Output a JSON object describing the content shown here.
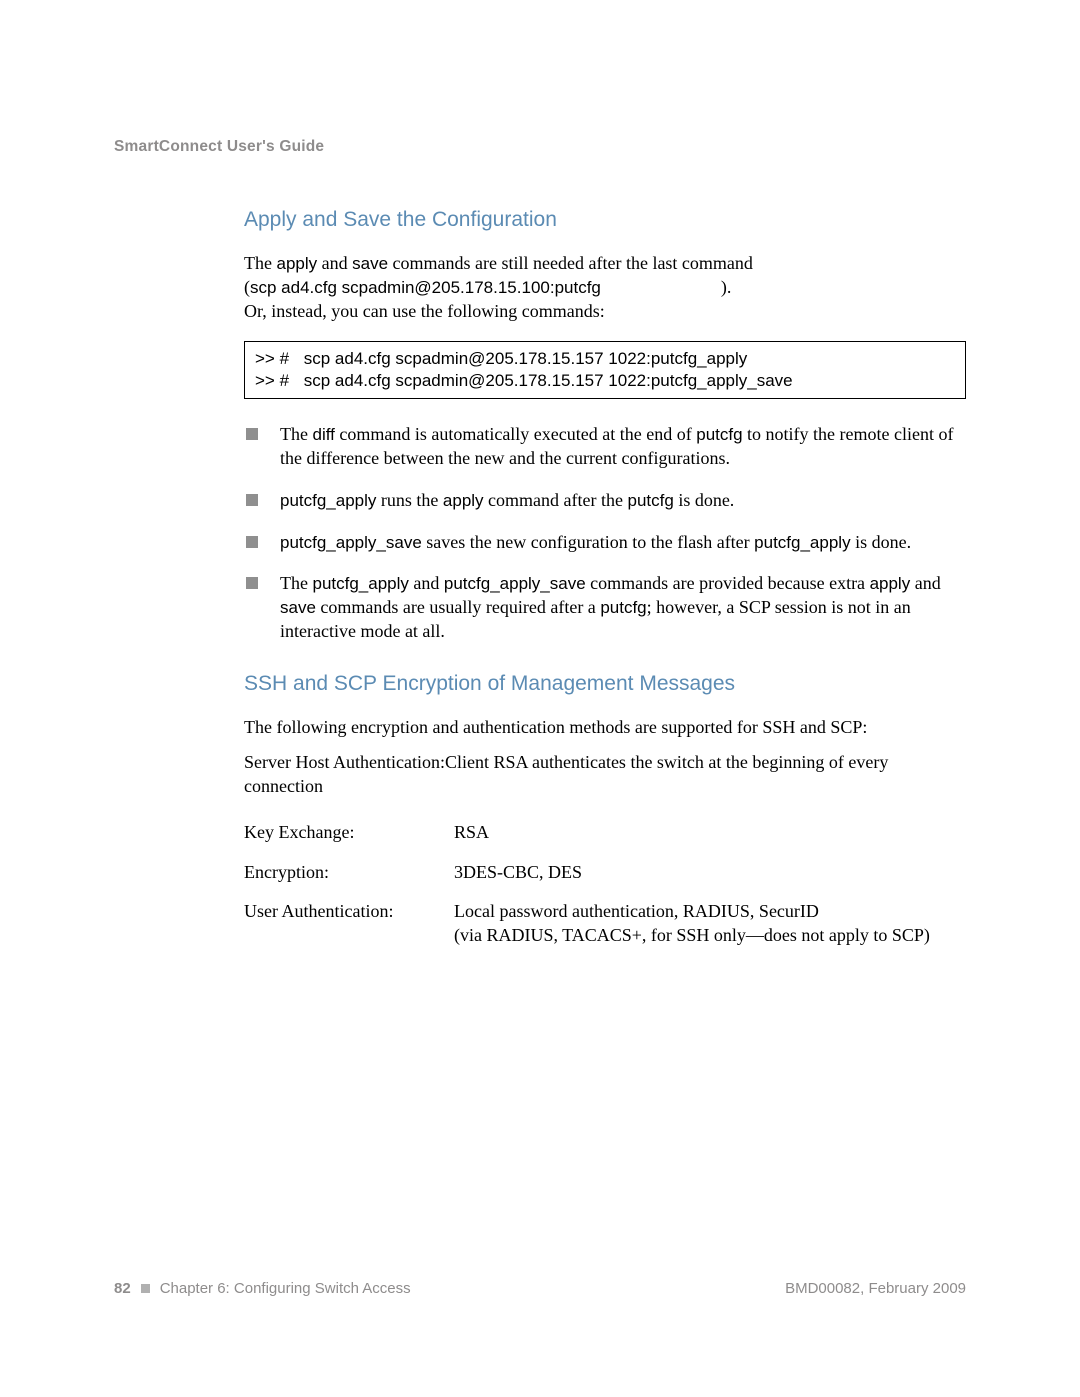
{
  "runhead": "SmartConnect User's Guide",
  "heading1": "Apply and Save the Configuration",
  "para1_pre": "The ",
  "para1_c1": "apply",
  "para1_mid1": " and ",
  "para1_c2": "save",
  "para1_post1": " commands are still needed after the last command",
  "para1_line2_open": "(",
  "para1_line2_cmd": "scp ad4.cfg scpadmin@205.178.15.100:putcfg",
  "para1_line2_close": ").",
  "para1_line3": "Or, instead, you can use the following commands:",
  "codebox_prompt": ">> #",
  "codebox_l1": "scp ad4.cfg scpadmin@205.178.15.157 1022:putcfg_apply",
  "codebox_l2": "scp ad4.cfg scpadmin@205.178.15.157 1022:putcfg_apply_save",
  "b1_pre": "The ",
  "b1_c1": "diff",
  "b1_mid": " command is automatically executed at the end of ",
  "b1_c2": "putcfg",
  "b1_post": " to notify the remote client of the difference between the new and the current configurations.",
  "b2_c1": "putcfg_apply",
  "b2_mid1": " runs the ",
  "b2_c2": "apply",
  "b2_mid2": " command after the ",
  "b2_c3": "putcfg",
  "b2_post": " is done.",
  "b3_c1": "putcfg_apply_save",
  "b3_mid": " saves the new configuration to the flash after ",
  "b3_c2": "putcfg_apply",
  "b3_post": " is done.",
  "b4_pre": "The ",
  "b4_c1": "putcfg_apply",
  "b4_mid1": " and ",
  "b4_c2": "putcfg_apply_save",
  "b4_mid2": " commands are provided because extra ",
  "b4_c3": "apply",
  "b4_mid3": " and ",
  "b4_c4": "save",
  "b4_mid4": " commands are usually required after a ",
  "b4_c5": "putcfg",
  "b4_post": "; however, a SCP session is not in an interactive mode at all.",
  "heading2": "SSH and SCP Encryption of Management Messages",
  "para2": "The following encryption and authentication methods are supported for SSH and SCP:",
  "para3": "Server Host Authentication:Client RSA authenticates the switch at the beginning of every connection",
  "def1_l": "Key Exchange:",
  "def1_v": "RSA",
  "def2_l": "Encryption:",
  "def2_v": "3DES-CBC, DES",
  "def3_l": "User Authentication:",
  "def3_v1": "Local password authentication, RADIUS, SecurID",
  "def3_v2": "(via RADIUS, TACACS+, for SSH only—does not apply to SCP)",
  "footer_page": "82",
  "footer_chapter": "Chapter 6: Configuring Switch Access",
  "footer_right": "BMD00082, February 2009"
}
